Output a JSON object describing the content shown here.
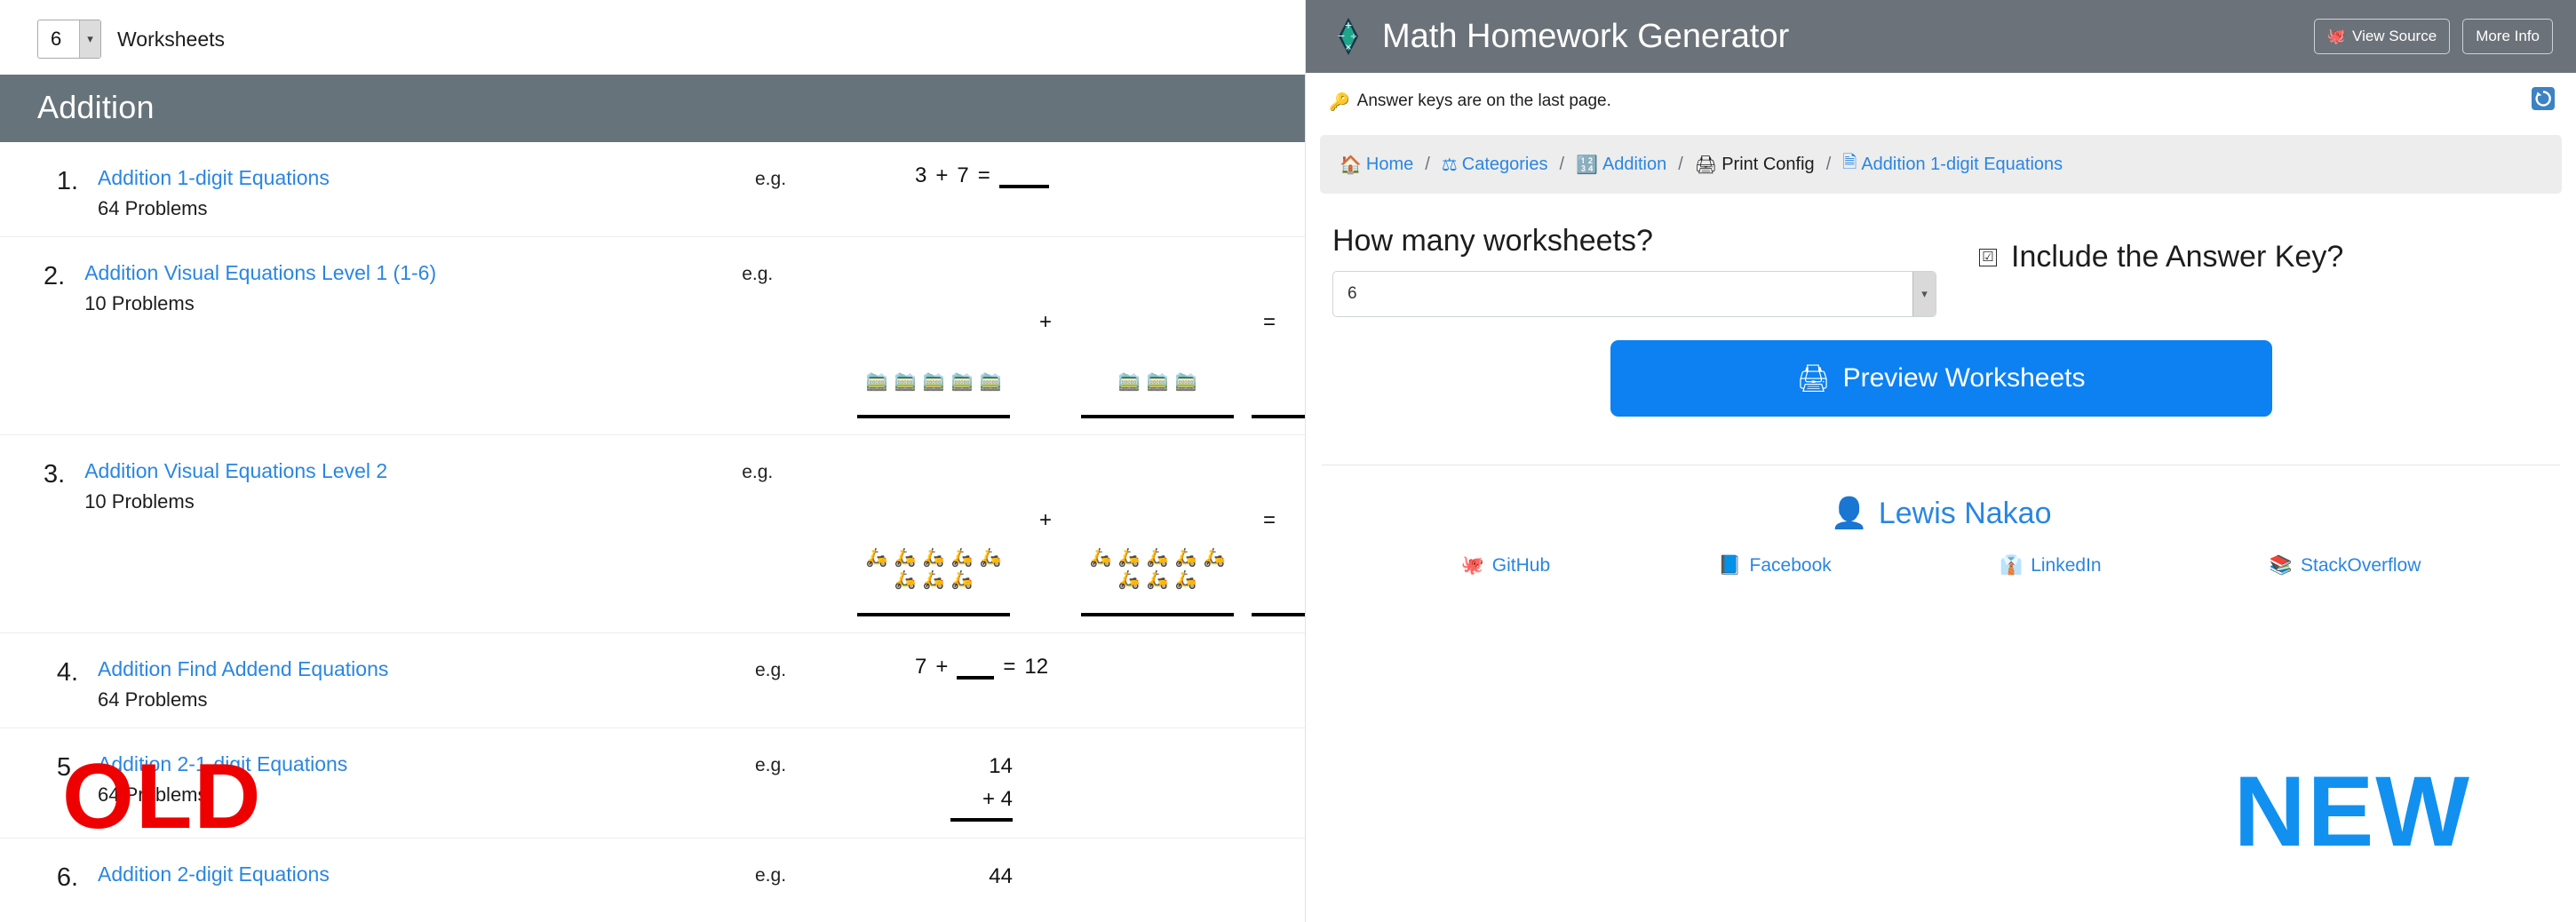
{
  "old_panel": {
    "worksheet_count_value": "6",
    "worksheet_count_label": "Worksheets",
    "section_title": "Addition",
    "eg_label": "e.g.",
    "stamp": "OLD",
    "rows": [
      {
        "num": "1.",
        "title": "Addition 1-digit Equations",
        "subtitle": "64 Problems",
        "example_type": "inline",
        "example": {
          "left": "3",
          "op": "+",
          "right": "7",
          "equals": "="
        }
      },
      {
        "num": "2.",
        "title": "Addition Visual Equations Level 1 (1-6)",
        "subtitle": "10 Problems",
        "example_type": "visual",
        "example": {
          "emoji": "🚞",
          "emoji_name": "mountain-railway",
          "left_count": 5,
          "right_count": 3,
          "op": "+",
          "equals": "="
        }
      },
      {
        "num": "3.",
        "title": "Addition Visual Equations Level 2",
        "subtitle": "10 Problems",
        "example_type": "visual",
        "example": {
          "emoji": "🛵",
          "emoji_name": "motor-scooter",
          "left_count": 8,
          "right_count": 8,
          "op": "+",
          "equals": "="
        }
      },
      {
        "num": "4.",
        "title": "Addition Find Addend Equations",
        "subtitle": "64 Problems",
        "example_type": "find-addend",
        "example": {
          "left": "7",
          "op": "+",
          "equals": "=",
          "result": "12"
        }
      },
      {
        "num": "5.",
        "title": "Addition 2-1-digit Equations",
        "subtitle": "64 Problems",
        "example_type": "stacked",
        "example": {
          "top": "14",
          "bottom": "+ 4"
        }
      },
      {
        "num": "6.",
        "title": "Addition 2-digit Equations",
        "subtitle": "",
        "example_type": "stacked",
        "example": {
          "top": "44",
          "bottom": ""
        }
      }
    ]
  },
  "new_panel": {
    "header": {
      "title": "Math Homework Generator",
      "logo_icon": "math-operations-diamond-icon",
      "view_source_label": "View Source",
      "view_source_icon": "octopus-icon",
      "more_info_label": "More Info"
    },
    "notice": {
      "text": "Answer keys are on the last page.",
      "icon": "key-icon",
      "refresh_icon": "refresh-icon"
    },
    "breadcrumb": [
      {
        "label": "Home",
        "icon": "house-icon",
        "link": true
      },
      {
        "label": "Categories",
        "icon": "scales-icon",
        "link": true
      },
      {
        "label": "Addition",
        "icon": "input-numbers-icon",
        "link": true
      },
      {
        "label": "Print Config",
        "icon": "printer-icon",
        "link": false
      },
      {
        "label": "Addition 1-digit Equations",
        "icon": "page-icon",
        "link": true
      }
    ],
    "breadcrumb_separator": "/",
    "form": {
      "question": "How many worksheets?",
      "select_value": "6",
      "answer_key_label": "Include the Answer Key?",
      "answer_key_checked": true,
      "answer_key_mark": "☑",
      "preview_button_label": "Preview Worksheets",
      "preview_button_icon": "printer-icon",
      "preview_button_color": "#0d81f2"
    },
    "footer": {
      "author": "Lewis Nakao",
      "author_icon": "person-bust-icon",
      "links": [
        {
          "label": "GitHub",
          "icon": "octopus-icon"
        },
        {
          "label": "Facebook",
          "icon": "book-icon"
        },
        {
          "label": "LinkedIn",
          "icon": "necktie-icon"
        },
        {
          "label": "StackOverflow",
          "icon": "books-icon"
        }
      ]
    },
    "stamp": "NEW",
    "stamp_color": "#1290ef"
  }
}
